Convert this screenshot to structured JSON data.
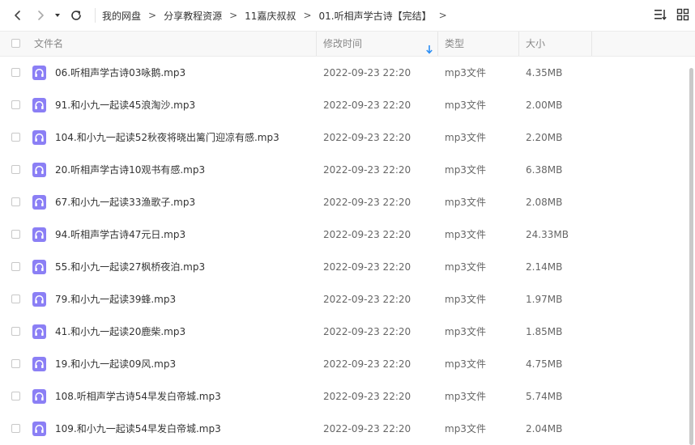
{
  "breadcrumb": {
    "items": [
      "我的网盘",
      "分享教程资源",
      "11嘉庆叔叔",
      "01.听相声学古诗【完结】"
    ],
    "separator": ">"
  },
  "columns": {
    "name": "文件名",
    "modified": "修改时间",
    "type": "类型",
    "size": "大小"
  },
  "icons": {
    "back": "chevron-left-icon",
    "forward": "chevron-right-icon",
    "history": "caret-down-icon",
    "refresh": "refresh-icon",
    "sort_view": "sort-list-icon",
    "grid_view": "grid-icon",
    "file": "audio-file-icon"
  },
  "colors": {
    "accent": "#2a8ef5",
    "file_icon": "#8b7ff5"
  },
  "files": [
    {
      "name": "06.听相声学古诗03咏鹅.mp3",
      "modified": "2022-09-23 22:20",
      "type": "mp3文件",
      "size": "4.35MB"
    },
    {
      "name": "91.和小九一起读45浪淘沙.mp3",
      "modified": "2022-09-23 22:20",
      "type": "mp3文件",
      "size": "2.00MB"
    },
    {
      "name": "104.和小九一起读52秋夜将晓出篱门迎凉有感.mp3",
      "modified": "2022-09-23 22:20",
      "type": "mp3文件",
      "size": "2.20MB"
    },
    {
      "name": "20.听相声学古诗10观书有感.mp3",
      "modified": "2022-09-23 22:20",
      "type": "mp3文件",
      "size": "6.38MB"
    },
    {
      "name": "67.和小九一起读33渔歌子.mp3",
      "modified": "2022-09-23 22:20",
      "type": "mp3文件",
      "size": "2.08MB"
    },
    {
      "name": "94.听相声学古诗47元日.mp3",
      "modified": "2022-09-23 22:20",
      "type": "mp3文件",
      "size": "24.33MB"
    },
    {
      "name": "55.和小九一起读27枫桥夜泊.mp3",
      "modified": "2022-09-23 22:20",
      "type": "mp3文件",
      "size": "2.14MB"
    },
    {
      "name": "79.和小九一起读39蜂.mp3",
      "modified": "2022-09-23 22:20",
      "type": "mp3文件",
      "size": "1.97MB"
    },
    {
      "name": "41.和小九一起读20鹿柴.mp3",
      "modified": "2022-09-23 22:20",
      "type": "mp3文件",
      "size": "1.85MB"
    },
    {
      "name": "19.和小九一起读09风.mp3",
      "modified": "2022-09-23 22:20",
      "type": "mp3文件",
      "size": "4.75MB"
    },
    {
      "name": "108.听相声学古诗54早发白帝城.mp3",
      "modified": "2022-09-23 22:20",
      "type": "mp3文件",
      "size": "5.74MB"
    },
    {
      "name": "109.和小九一起读54早发白帝城.mp3",
      "modified": "2022-09-23 22:20",
      "type": "mp3文件",
      "size": "2.04MB"
    }
  ]
}
